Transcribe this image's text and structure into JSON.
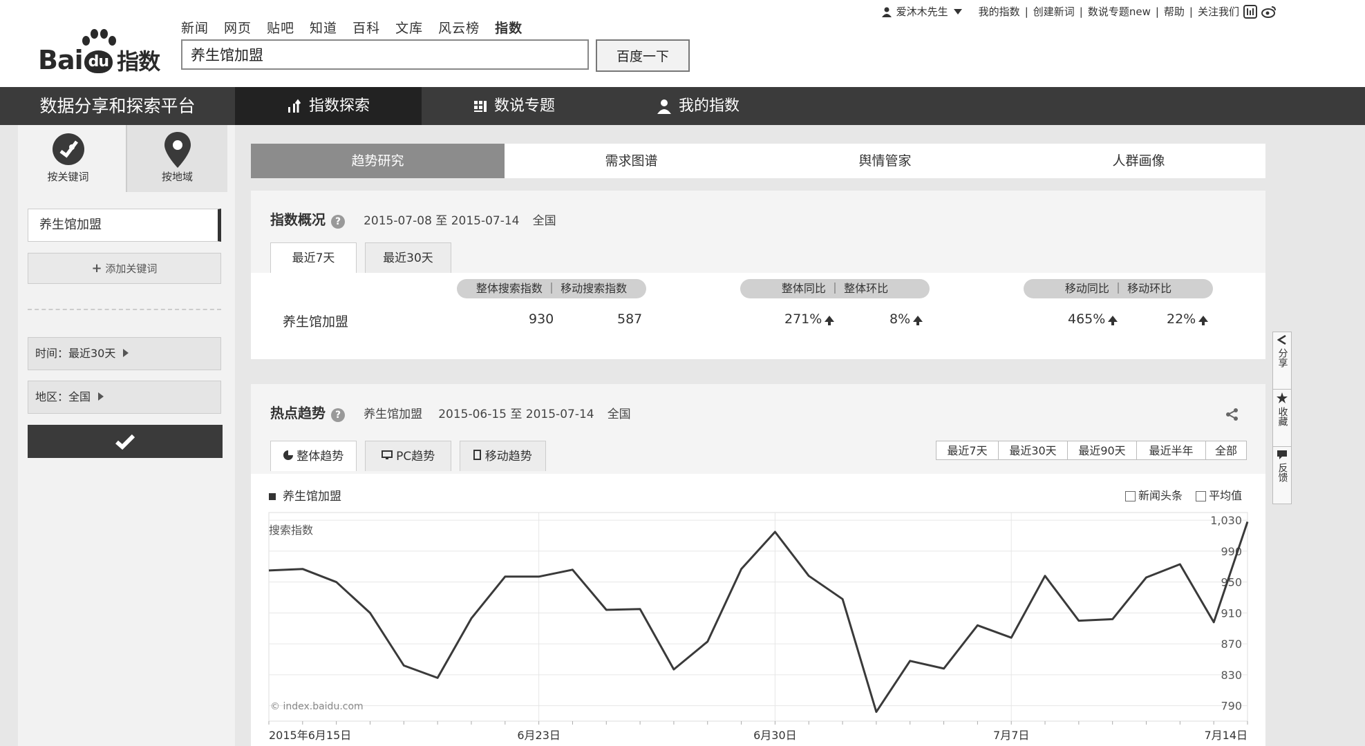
{
  "header": {
    "logo_text": "Bai",
    "logo_du": "du",
    "logo_cn": "指数",
    "nav": [
      "新闻",
      "网页",
      "贴吧",
      "知道",
      "百科",
      "文库",
      "风云榜",
      "指数"
    ],
    "nav_active": "指数",
    "search_value": "养生馆加盟",
    "search_button": "百度一下",
    "user": "爱沐木先生",
    "links": [
      "我的指数",
      "创建新词",
      "数说专题new",
      "帮助",
      "关注我们"
    ]
  },
  "darknav": {
    "title": "数据分享和探索平台",
    "items": [
      "指数探索",
      "数说专题",
      "我的指数"
    ]
  },
  "sidebar": {
    "tab_keyword": "按关键词",
    "tab_region": "按地域",
    "keyword": "养生馆加盟",
    "add_keyword": "添加关键词",
    "filter_time": "时间：最近30天",
    "filter_region": "地区：全国"
  },
  "section_tabs": [
    "趋势研究",
    "需求图谱",
    "舆情管家",
    "人群画像"
  ],
  "overview": {
    "title": "指数概况",
    "date_range": "2015-07-08 至 2015-07-14",
    "region": "全国",
    "tabs": [
      "最近7天",
      "最近30天"
    ],
    "pill1": "整体搜索指数 ｜ 移动搜索指数",
    "pill2": "整体同比 ｜ 整体环比",
    "pill3": "移动同比 ｜ 移动环比",
    "keyword": "养生馆加盟",
    "total_search": "930",
    "mobile_search": "587",
    "total_yoy": "271%",
    "total_mom": "8%",
    "mobile_yoy": "465%",
    "mobile_mom": "22%"
  },
  "trend": {
    "title": "热点趋势",
    "keyword": "养生馆加盟",
    "date_range": "2015-06-15 至 2015-07-14",
    "region": "全国",
    "tabs": [
      "整体趋势",
      "PC趋势",
      "移动趋势"
    ],
    "ranges": [
      "最近7天",
      "最近30天",
      "最近90天",
      "最近半年",
      "全部"
    ],
    "legend": "养生馆加盟",
    "opt_news": "新闻头条",
    "opt_avg": "平均值",
    "watermark": "© index.baidu.com"
  },
  "float_buttons": [
    "分享",
    "收藏",
    "反馈"
  ],
  "chart_data": {
    "type": "line",
    "ylabel": "搜索指数",
    "y_ticks": [
      790,
      830,
      870,
      910,
      950,
      990,
      1030
    ],
    "y_tick_labels": [
      "790",
      "830",
      "870",
      "910",
      "950",
      "990",
      "1,030"
    ],
    "ylim": [
      770,
      1040
    ],
    "x_tick_labels": [
      "2015年6月15日",
      "6月23日",
      "6月30日",
      "7月7日",
      "7月14日"
    ],
    "x_tick_index": [
      0,
      8,
      15,
      22,
      29
    ],
    "grid": true,
    "series": [
      {
        "name": "养生馆加盟",
        "values": [
          965,
          967,
          950,
          910,
          842,
          826,
          903,
          957,
          957,
          966,
          914,
          915,
          837,
          873,
          967,
          1015,
          958,
          928,
          782,
          848,
          838,
          894,
          878,
          958,
          900,
          902,
          956,
          973,
          898,
          1028
        ]
      }
    ]
  }
}
